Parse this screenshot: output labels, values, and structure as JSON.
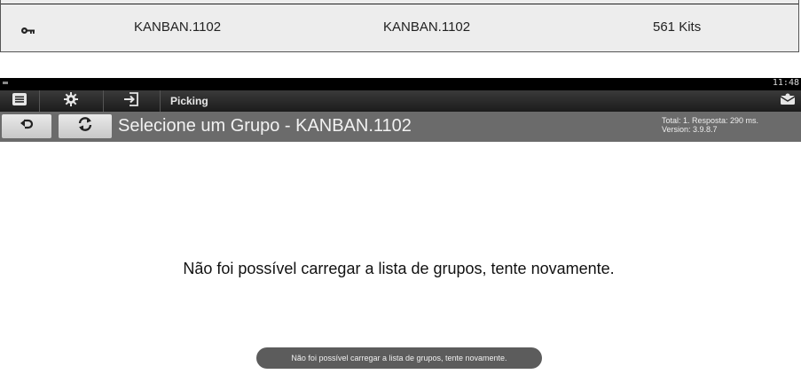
{
  "top_table": {
    "row": {
      "icon": "key-icon",
      "col1": "KANBAN.1102",
      "col2": "KANBAN.1102",
      "col3": "561 Kits"
    }
  },
  "statusbar": {
    "time": "11:48"
  },
  "toolbar": {
    "buttons": [
      "list-icon",
      "gear-icon",
      "login-icon"
    ],
    "title": "Picking",
    "right_icon": "envelope-icon"
  },
  "header": {
    "title": "Selecione um Grupo - KANBAN.1102",
    "info_line1": "Total: 1. Resposta: 290 ms.",
    "info_line2": "Version: 3.9.8.7",
    "back_icon": "back-arrow-icon",
    "refresh_icon": "refresh-icon"
  },
  "main": {
    "message": "Não foi possível carregar a lista de grupos, tente novamente."
  },
  "toast": {
    "message": "Não foi possível carregar a lista de grupos, tente novamente."
  },
  "colors": {
    "toolbar_bg": "#2a2a2a",
    "header_bg": "#6b6b6b",
    "toast_bg": "#5c5c5c",
    "row_bg": "#ededed"
  }
}
